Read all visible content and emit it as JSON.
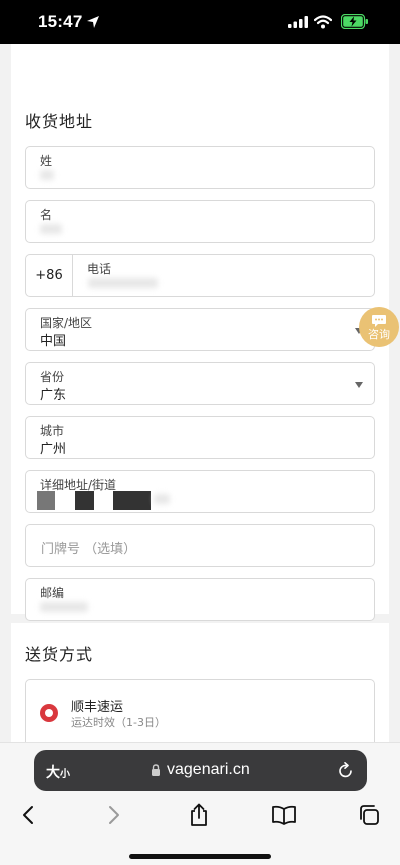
{
  "status_bar": {
    "time": "15:47"
  },
  "address_section": {
    "title": "收货地址",
    "fields": {
      "last_name": {
        "label": "姓"
      },
      "first_name": {
        "label": "名"
      },
      "phone": {
        "prefix": "+86",
        "label": "电话"
      },
      "country": {
        "label": "国家/地区",
        "value": "中国"
      },
      "province": {
        "label": "省份",
        "value": "广东"
      },
      "city": {
        "label": "城市",
        "value": "广州"
      },
      "street": {
        "label": "详细地址/街道"
      },
      "house_number": {
        "placeholder": "门牌号 （选填）"
      },
      "zip": {
        "label": "邮编"
      }
    }
  },
  "consult": {
    "label": "咨询",
    "color": "#eac274"
  },
  "shipping_section": {
    "title": "送货方式",
    "option": {
      "name": "顺丰速运",
      "time": "运达时效（1-3日）",
      "selected": true,
      "radio_color": "#d9383e"
    }
  },
  "browser": {
    "text_size": {
      "big": "大",
      "small": "小"
    },
    "url": "vagenari.cn"
  }
}
